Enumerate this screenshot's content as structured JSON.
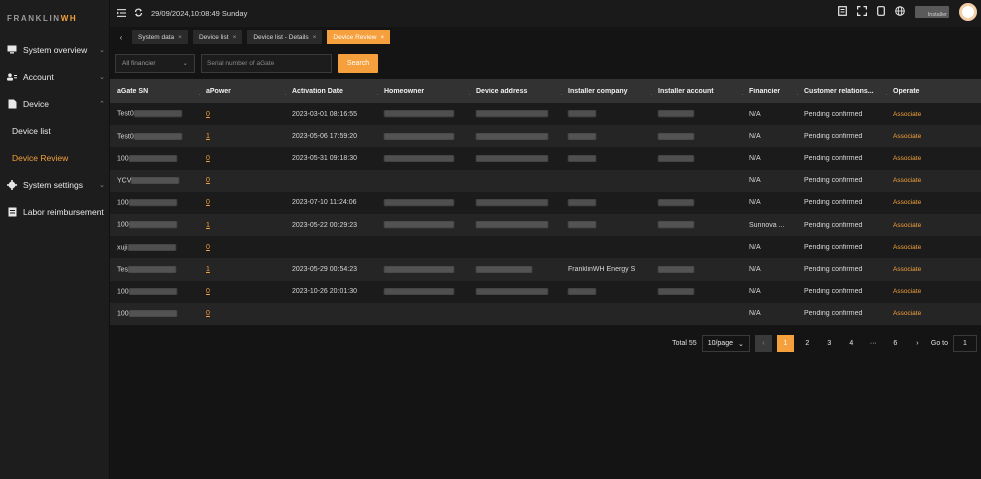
{
  "brand": {
    "logo_main": "FRANKLIN",
    "logo_accent": "WH"
  },
  "topbar": {
    "datetime": "29/09/2024,10:08:49 Sunday",
    "user_label": "Installer"
  },
  "tabs": [
    {
      "label": "System data",
      "close": "×"
    },
    {
      "label": "Device list",
      "close": "×"
    },
    {
      "label": "Device list - Details",
      "close": "×"
    },
    {
      "label": "Device Review",
      "close": "×"
    }
  ],
  "sidebar": {
    "items": [
      {
        "label": "System overview",
        "icon": "monitor-icon"
      },
      {
        "label": "Account",
        "icon": "users-icon"
      },
      {
        "label": "Device",
        "icon": "device-icon"
      },
      {
        "label": "Device list",
        "icon": ""
      },
      {
        "label": "Device Review",
        "icon": ""
      },
      {
        "label": "System settings",
        "icon": "gear-icon"
      },
      {
        "label": "Labor reimbursement",
        "icon": "receipt-icon"
      }
    ]
  },
  "filters": {
    "financier_placeholder": "All financier",
    "serial_placeholder": "Serial number of aGate",
    "search_label": "Search"
  },
  "table": {
    "headers": [
      "aGate SN",
      "aPower",
      "Activation Date",
      "Homeowner",
      "Device address",
      "Installer company",
      "Installer account",
      "Financier",
      "Customer relations...",
      "Operate"
    ],
    "rows": [
      {
        "sn": "Test0",
        "power": "0",
        "date": "2023-03-01 08:16:55",
        "company": "",
        "financier": "N/A",
        "status": "Pending confirmed",
        "op": "Associate"
      },
      {
        "sn": "Test0",
        "power": "1",
        "date": "2023-05-06 17:59:20",
        "company": "",
        "financier": "N/A",
        "status": "Pending confirmed",
        "op": "Associate"
      },
      {
        "sn": "100",
        "power": "0",
        "date": "2023-05-31 09:18:30",
        "company": "",
        "financier": "N/A",
        "status": "Pending confirmed",
        "op": "Associate"
      },
      {
        "sn": "YCV",
        "power": "0",
        "date": "",
        "company": "",
        "financier": "N/A",
        "status": "Pending confirmed",
        "op": "Associate"
      },
      {
        "sn": "100",
        "power": "0",
        "date": "2023-07-10 11:24:06",
        "company": "",
        "financier": "N/A",
        "status": "Pending confirmed",
        "op": "Associate"
      },
      {
        "sn": "100",
        "power": "1",
        "date": "2023-05-22 00:29:23",
        "company": "",
        "financier": "Sunnova ...",
        "status": "Pending confirmed",
        "op": "Associate"
      },
      {
        "sn": "xuji",
        "power": "0",
        "date": "",
        "company": "",
        "financier": "N/A",
        "status": "Pending confirmed",
        "op": "Associate"
      },
      {
        "sn": "Tes",
        "power": "1",
        "date": "2023-05-29 00:54:23",
        "company": "FranklinWH Energy S",
        "financier": "N/A",
        "status": "Pending confirmed",
        "op": "Associate"
      },
      {
        "sn": "100",
        "power": "0",
        "date": "2023-10-26 20:01:30",
        "company": "",
        "financier": "N/A",
        "status": "Pending confirmed",
        "op": "Associate"
      },
      {
        "sn": "100",
        "power": "0",
        "date": "",
        "company": "",
        "financier": "N/A",
        "status": "Pending confirmed",
        "op": "Associate"
      }
    ]
  },
  "pagination": {
    "total": "Total 55",
    "page_size": "10/page",
    "pages": [
      "1",
      "2",
      "3",
      "4",
      "···",
      "6"
    ],
    "goto_label": "Go to",
    "goto_value": "1"
  }
}
